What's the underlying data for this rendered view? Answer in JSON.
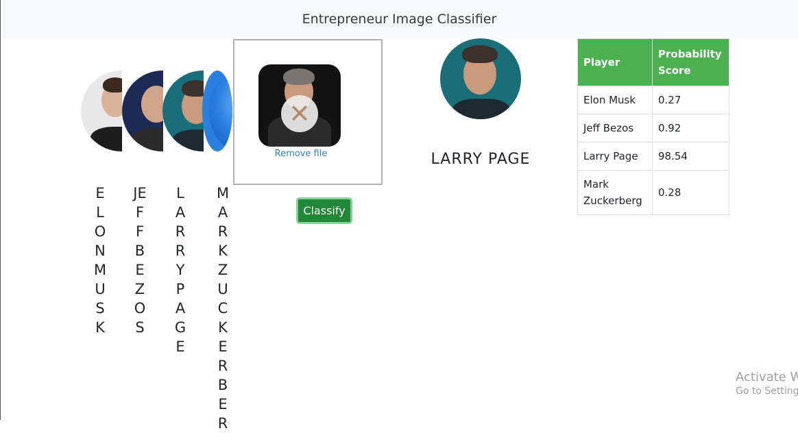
{
  "navbar": {
    "title": "Entrepreneur Image Classifier"
  },
  "gallery": [
    {
      "id": "elon",
      "name_vertical": "ELONMUSK"
    },
    {
      "id": "jeff",
      "name_vertical": "JEFFBEZOS"
    },
    {
      "id": "larry",
      "name_vertical": "LARRYPAGE"
    },
    {
      "id": "mark",
      "name_vertical": "MARKZUCKERBER"
    }
  ],
  "dropzone": {
    "remove_label": "Remove file"
  },
  "classify_button": {
    "label": "Classify"
  },
  "result": {
    "name": "LARRY PAGE"
  },
  "table": {
    "headers": [
      "Player",
      "Probability Score"
    ],
    "rows": [
      {
        "player": "Elon Musk",
        "score": "0.27"
      },
      {
        "player": "Jeff Bezos",
        "score": "0.92"
      },
      {
        "player": "Larry Page",
        "score": "98.54"
      },
      {
        "player": "Mark Zuckerberg",
        "score": "0.28"
      }
    ]
  },
  "watermark": {
    "line1": "Activate W",
    "line2": "Go to Settings"
  },
  "colors": {
    "table_header": "#4caf50",
    "classify_button": "#218838",
    "link": "#2f7fd6"
  }
}
